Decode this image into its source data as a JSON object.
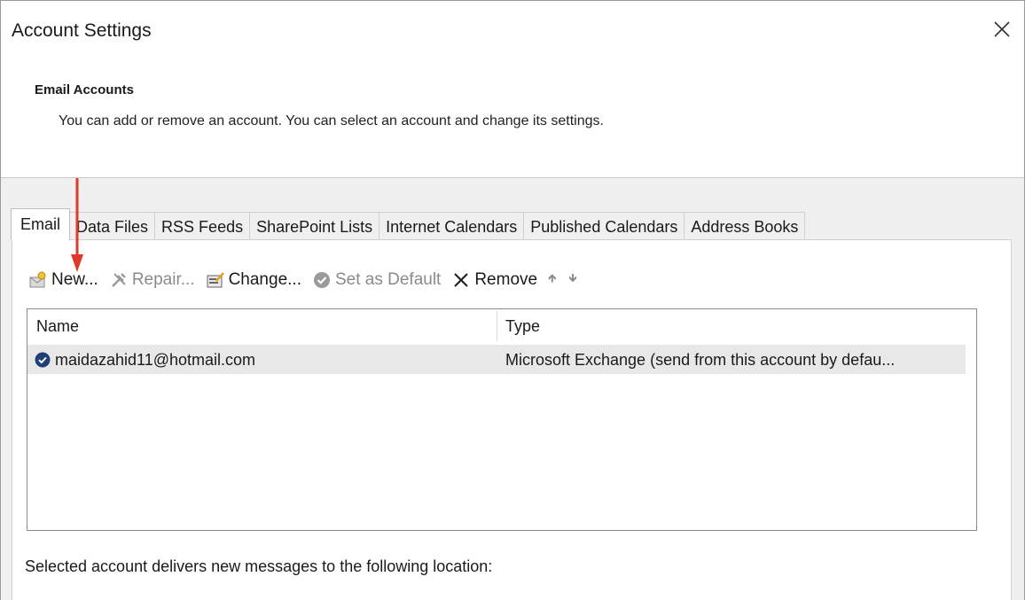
{
  "window": {
    "title": "Account Settings"
  },
  "header": {
    "section_title": "Email Accounts",
    "description": "You can add or remove an account. You can select an account and change its settings."
  },
  "tabs": [
    {
      "label": "Email",
      "active": true
    },
    {
      "label": "Data Files",
      "active": false
    },
    {
      "label": "RSS Feeds",
      "active": false
    },
    {
      "label": "SharePoint Lists",
      "active": false
    },
    {
      "label": "Internet Calendars",
      "active": false
    },
    {
      "label": "Published Calendars",
      "active": false
    },
    {
      "label": "Address Books",
      "active": false
    }
  ],
  "toolbar": {
    "new_label": "New...",
    "repair_label": "Repair...",
    "change_label": "Change...",
    "set_default_label": "Set as Default",
    "remove_label": "Remove"
  },
  "list": {
    "columns": {
      "name": "Name",
      "type": "Type"
    },
    "rows": [
      {
        "name": "maidazahid11@hotmail.com",
        "type": "Microsoft Exchange (send from this account by defau..."
      }
    ]
  },
  "delivery_text": "Selected account delivers new messages to the following location:",
  "colors": {
    "annotation_arrow": "#e0392b",
    "check_icon": "#1f3f78",
    "tab_panel_bg": "#ffffff",
    "dialog_gray": "#f0f0f0"
  }
}
